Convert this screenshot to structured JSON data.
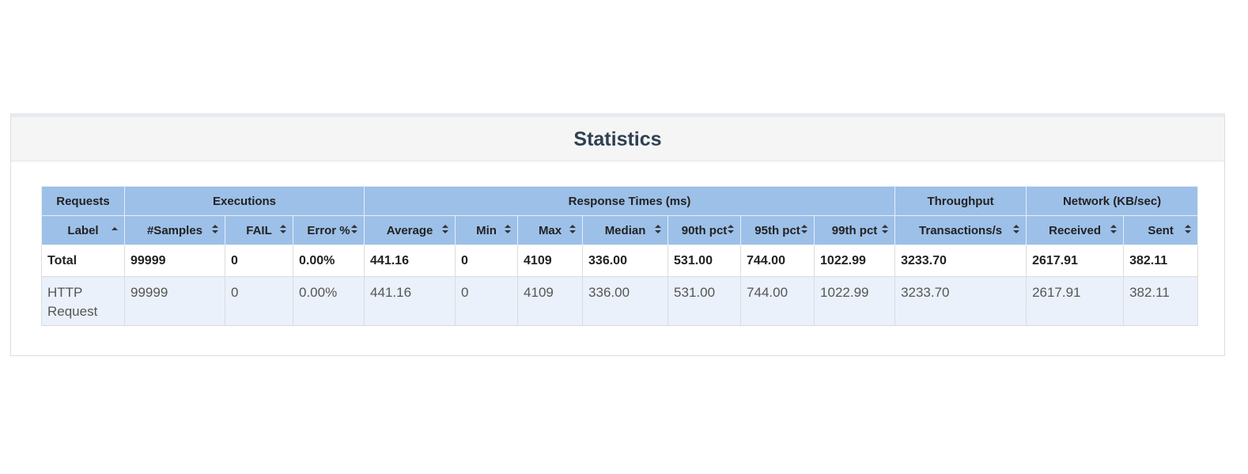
{
  "panel": {
    "title": "Statistics"
  },
  "table": {
    "groups": [
      "Requests",
      "Executions",
      "Response Times (ms)",
      "Throughput",
      "Network (KB/sec)"
    ],
    "columns": [
      "Label",
      "#Samples",
      "FAIL",
      "Error %",
      "Average",
      "Min",
      "Max",
      "Median",
      "90th pct",
      "95th pct",
      "99th pct",
      "Transactions/s",
      "Received",
      "Sent"
    ],
    "sort": {
      "column": "Label",
      "direction": "ascending"
    },
    "total": [
      "Total",
      "99999",
      "0",
      "0.00%",
      "441.16",
      "0",
      "4109",
      "336.00",
      "531.00",
      "744.00",
      "1022.99",
      "3233.70",
      "2617.91",
      "382.11"
    ],
    "rows": [
      [
        "HTTP Request",
        "99999",
        "0",
        "0.00%",
        "441.16",
        "0",
        "4109",
        "336.00",
        "531.00",
        "744.00",
        "1022.99",
        "3233.70",
        "2617.91",
        "382.11"
      ]
    ]
  },
  "colors": {
    "header_bg": "#9dc0e8",
    "row_bg": "#eaf1fa",
    "title": "#2f4050"
  }
}
